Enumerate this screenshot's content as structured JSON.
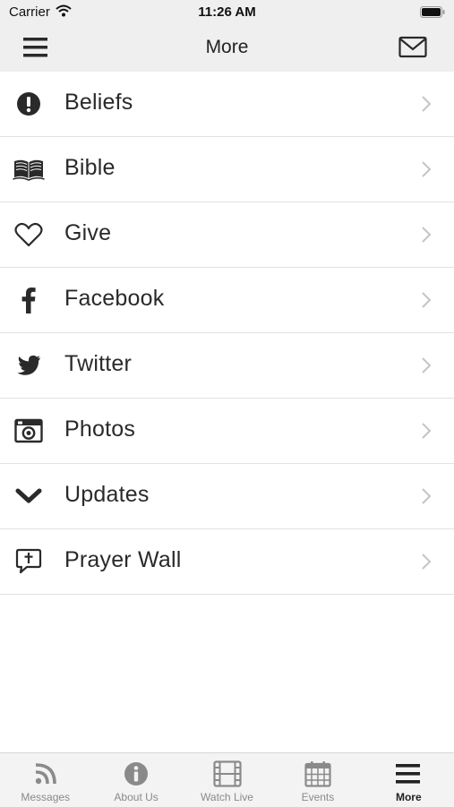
{
  "status_bar": {
    "carrier": "Carrier",
    "time": "11:26 AM"
  },
  "nav": {
    "title": "More"
  },
  "menu": {
    "items": [
      {
        "label": "Beliefs",
        "icon": "exclamation-circle-icon"
      },
      {
        "label": "Bible",
        "icon": "book-icon"
      },
      {
        "label": "Give",
        "icon": "heart-icon"
      },
      {
        "label": "Facebook",
        "icon": "facebook-icon"
      },
      {
        "label": "Twitter",
        "icon": "twitter-icon"
      },
      {
        "label": "Photos",
        "icon": "camera-icon"
      },
      {
        "label": "Updates",
        "icon": "chevron-down-icon"
      },
      {
        "label": "Prayer Wall",
        "icon": "prayer-bubble-icon"
      }
    ]
  },
  "tab_bar": {
    "tabs": [
      {
        "label": "Messages",
        "icon": "rss-icon",
        "active": false
      },
      {
        "label": "About Us",
        "icon": "info-icon",
        "active": false
      },
      {
        "label": "Watch Live",
        "icon": "film-icon",
        "active": false
      },
      {
        "label": "Events",
        "icon": "calendar-icon",
        "active": false
      },
      {
        "label": "More",
        "icon": "menu-icon",
        "active": true
      }
    ]
  },
  "colors": {
    "bar_background": "#efefef",
    "icon": "#2a2a2a",
    "chevron": "#c4c4c4",
    "inactive_tab": "#8a8a8a",
    "active_tab": "#222222"
  }
}
